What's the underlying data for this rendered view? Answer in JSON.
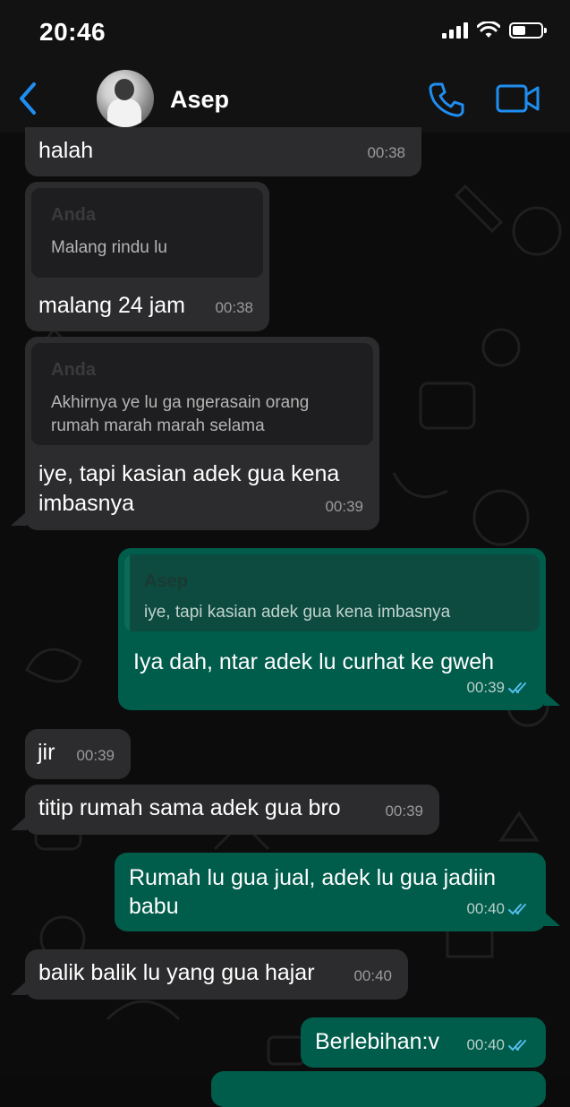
{
  "status_bar": {
    "time": "20:46"
  },
  "header": {
    "contact_name": "Asep"
  },
  "messages": [
    {
      "id": "m1",
      "direction": "in",
      "text": "halah",
      "time": "00:38"
    },
    {
      "id": "m2",
      "direction": "in",
      "quote": {
        "author": "Anda",
        "text": "Malang rindu lu"
      },
      "text": "malang 24 jam",
      "time": "00:38"
    },
    {
      "id": "m3",
      "direction": "in",
      "quote": {
        "author": "Anda",
        "text_lines": [
          "Akhirnya ye lu ga ngerasain orang",
          "rumah marah marah selama"
        ]
      },
      "text_lines": [
        "iye, tapi kasian adek gua kena",
        "imbasnya"
      ],
      "time": "00:39"
    },
    {
      "id": "m4",
      "direction": "out",
      "quote": {
        "author": "Asep",
        "text": "iye, tapi kasian adek gua kena imbasnya"
      },
      "text": "Iya dah, ntar adek lu curhat ke gweh",
      "time": "00:39",
      "read": true
    },
    {
      "id": "m5",
      "direction": "in",
      "text": "jir",
      "time": "00:39"
    },
    {
      "id": "m6",
      "direction": "in",
      "text": "titip rumah sama adek gua bro",
      "time": "00:39"
    },
    {
      "id": "m7",
      "direction": "out",
      "text_lines": [
        "Rumah lu gua jual, adek lu gua jadiin",
        "babu"
      ],
      "time": "00:40",
      "read": true
    },
    {
      "id": "m8",
      "direction": "in",
      "text": "balik balik lu yang gua hajar",
      "time": "00:40"
    },
    {
      "id": "m9",
      "direction": "out",
      "text": "Berlebihan:v",
      "time": "00:40",
      "read": true
    }
  ],
  "colors": {
    "accent": "#1f8ef1",
    "incoming_bubble": "#2c2c2e",
    "outgoing_bubble": "#005c4b",
    "read_tick": "#53bdeb",
    "background": "#0c0c0c"
  },
  "icons": {
    "back": "chevron-left-icon",
    "call": "phone-icon",
    "video": "video-camera-icon",
    "read_receipt": "double-check-icon"
  }
}
